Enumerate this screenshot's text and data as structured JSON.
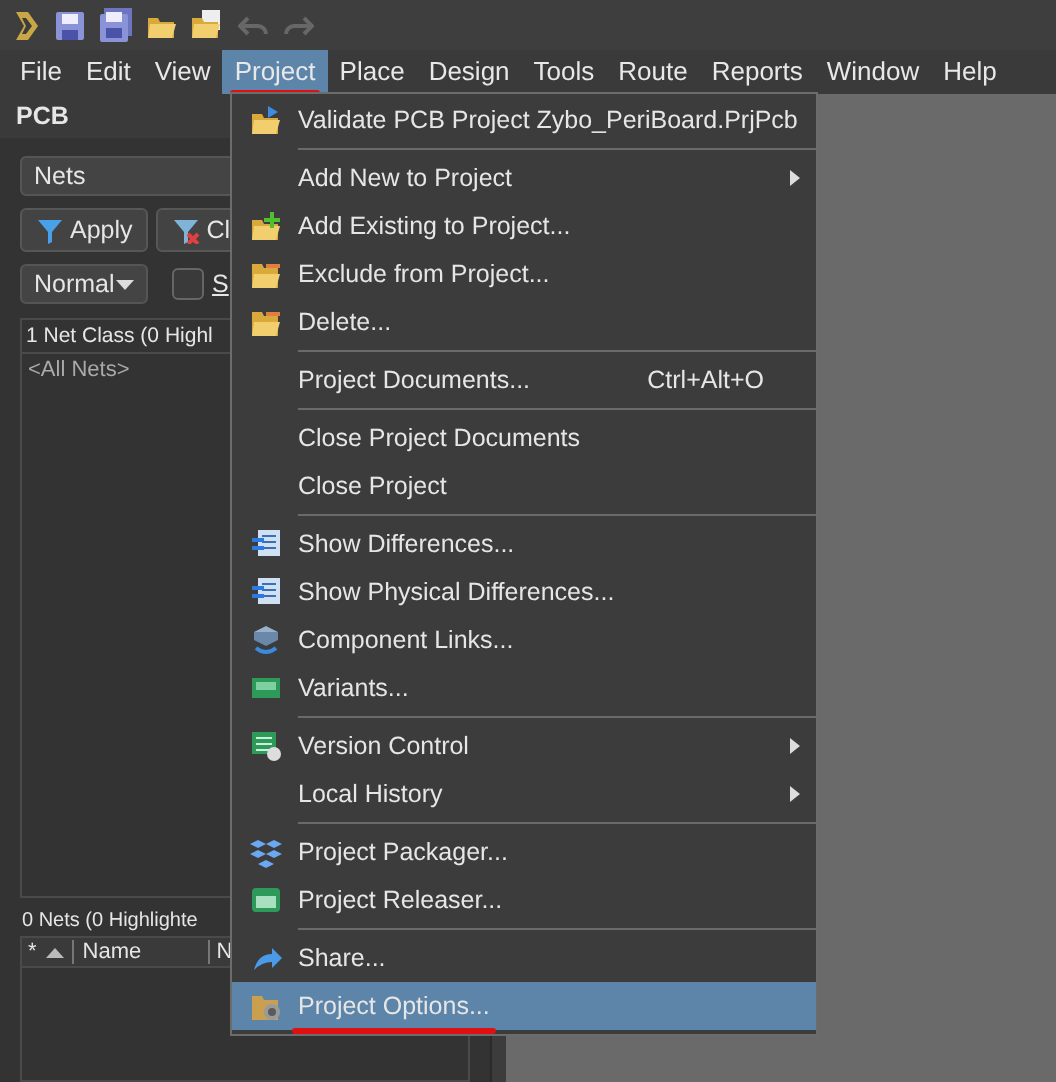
{
  "toolbar": {
    "undo_disabled": true,
    "redo_disabled": true
  },
  "menubar": [
    {
      "label": "File",
      "selected": false
    },
    {
      "label": "Edit",
      "selected": false
    },
    {
      "label": "View",
      "selected": false
    },
    {
      "label": "Project",
      "selected": true
    },
    {
      "label": "Place",
      "selected": false
    },
    {
      "label": "Design",
      "selected": false
    },
    {
      "label": "Tools",
      "selected": false
    },
    {
      "label": "Route",
      "selected": false
    },
    {
      "label": "Reports",
      "selected": false
    },
    {
      "label": "Window",
      "selected": false
    },
    {
      "label": "Help",
      "selected": false
    }
  ],
  "panel": {
    "title": "PCB",
    "scope_dropdown": "Nets",
    "apply_button": "Apply",
    "clear_button": "Cl",
    "mode_dropdown": "Normal",
    "select_checkbox": {
      "label": "S",
      "checked": false
    },
    "class_header": "1 Net Class (0 Highl",
    "class_items": [
      "<All Nets>"
    ],
    "nets_header": "0 Nets (0 Highlighte",
    "columns": [
      "*",
      "Name",
      "N"
    ]
  },
  "project_menu": [
    {
      "kind": "item",
      "label": "Validate PCB Project Zybo_PeriBoard.PrjPcb",
      "selected": false
    },
    {
      "kind": "separator"
    },
    {
      "kind": "item",
      "label": "Add New to Project",
      "submenu": true,
      "selected": false
    },
    {
      "kind": "item",
      "label": "Add Existing to Project...",
      "selected": false
    },
    {
      "kind": "item",
      "label": "Exclude from Project...",
      "selected": false
    },
    {
      "kind": "item",
      "label": "Delete...",
      "selected": false
    },
    {
      "kind": "separator"
    },
    {
      "kind": "item",
      "label": "Project Documents...",
      "shortcut": "Ctrl+Alt+O",
      "selected": false
    },
    {
      "kind": "separator"
    },
    {
      "kind": "item",
      "label": "Close Project Documents",
      "selected": false
    },
    {
      "kind": "item",
      "label": "Close Project",
      "selected": false
    },
    {
      "kind": "separator"
    },
    {
      "kind": "item",
      "label": "Show Differences...",
      "selected": false
    },
    {
      "kind": "item",
      "label": "Show Physical Differences...",
      "selected": false
    },
    {
      "kind": "item",
      "label": "Component Links...",
      "selected": false
    },
    {
      "kind": "item",
      "label": "Variants...",
      "selected": false
    },
    {
      "kind": "separator"
    },
    {
      "kind": "item",
      "label": "Version Control",
      "submenu": true,
      "selected": false
    },
    {
      "kind": "item",
      "label": "Local History",
      "submenu": true,
      "selected": false
    },
    {
      "kind": "separator"
    },
    {
      "kind": "item",
      "label": "Project Packager...",
      "selected": false
    },
    {
      "kind": "item",
      "label": "Project Releaser...",
      "selected": false
    },
    {
      "kind": "separator"
    },
    {
      "kind": "item",
      "label": "Share...",
      "selected": false
    },
    {
      "kind": "item",
      "label": "Project Options...",
      "selected": true
    }
  ]
}
